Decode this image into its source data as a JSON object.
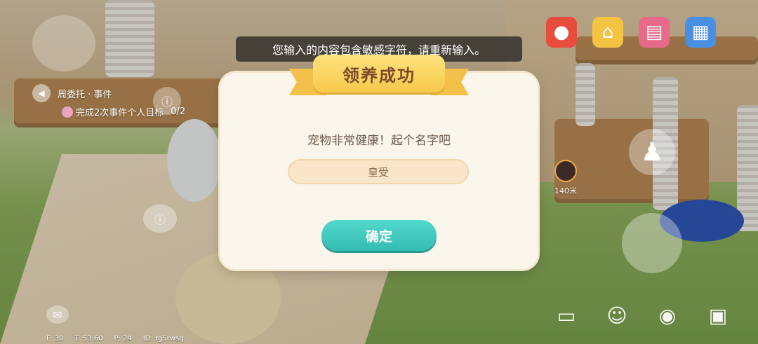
{
  "toast": "您输入的内容包含敏感字符，请重新输入。",
  "hud": {
    "task_title": "周委托 · 事件",
    "quest_text": "完成2次事件个人目标",
    "quest_progress": "0/2"
  },
  "distance_label": "140米",
  "dialog": {
    "title": "领养成功",
    "message": "宠物非常健康！起个名字吧",
    "name_value": "皇受",
    "confirm_label": "确定"
  },
  "stats": {
    "f": "F: 30",
    "t": "T: 53.60",
    "p": "P: 24",
    "id": "ID: rg5rwsq"
  },
  "colors": {
    "confirm_button": "#3cc7bb",
    "ribbon": "#f7c94b",
    "dialog_bg": "#fbf6ec"
  }
}
